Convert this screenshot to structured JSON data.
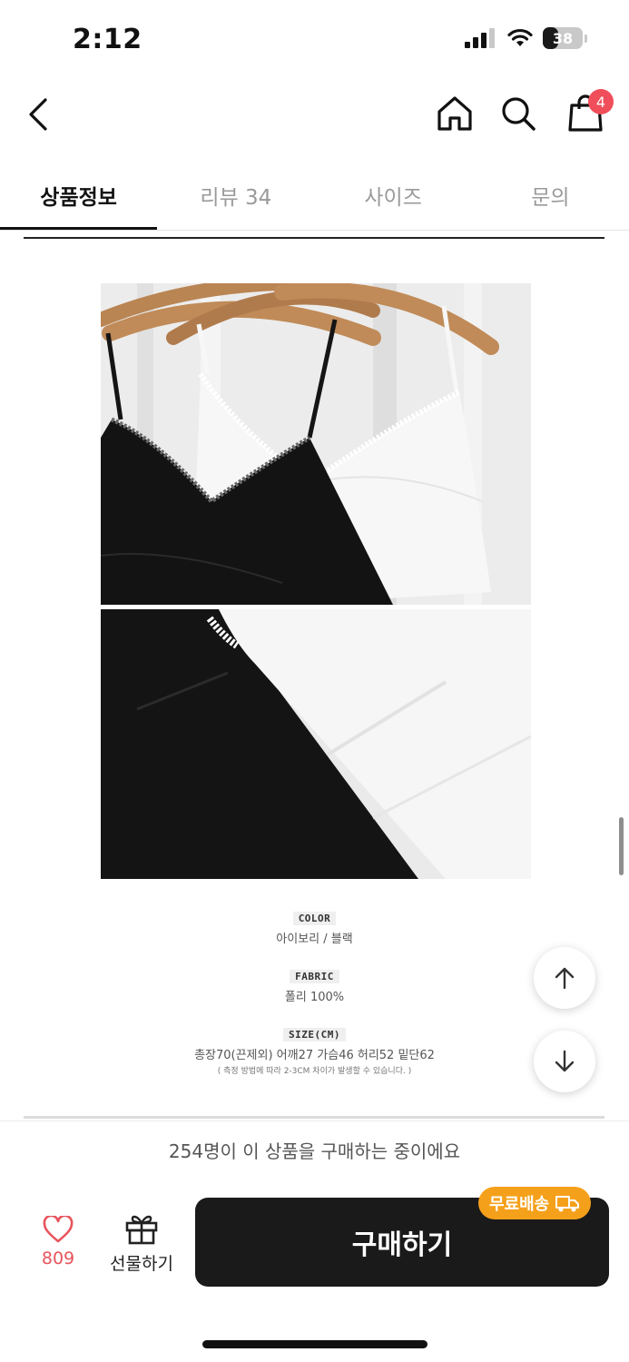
{
  "status_bar": {
    "time": "2:12",
    "battery": "38",
    "battery_level": 0.38
  },
  "nav": {
    "cart_count": "4"
  },
  "tabs": [
    {
      "label": "상품정보",
      "active": true
    },
    {
      "label": "리뷰 34",
      "active": false
    },
    {
      "label": "사이즈",
      "active": false
    },
    {
      "label": "문의",
      "active": false
    }
  ],
  "specs": {
    "color_label": "COLOR",
    "color_value": "아이보리     /     블랙",
    "fabric_label": "FABRIC",
    "fabric_value": "폴리 100%",
    "size_label": "SIZE(CM)",
    "size_value": "총장70(끈제외) 어깨27 가슴46 허리52 밑단62",
    "size_note": "( 측정 방법에 따라 2-3CM 차이가 발생할 수 있습니다. )"
  },
  "buying_notice": "254명이 이 상품을 구매하는 중이에요",
  "actions": {
    "like_count": "809",
    "gift_label": "선물하기",
    "buy_label": "구매하기",
    "free_shipping": "무료배송"
  },
  "colors": {
    "accent_red": "#f04e5a",
    "shipping_badge": "#f5a01a",
    "buy_button": "#1a1a1a"
  }
}
